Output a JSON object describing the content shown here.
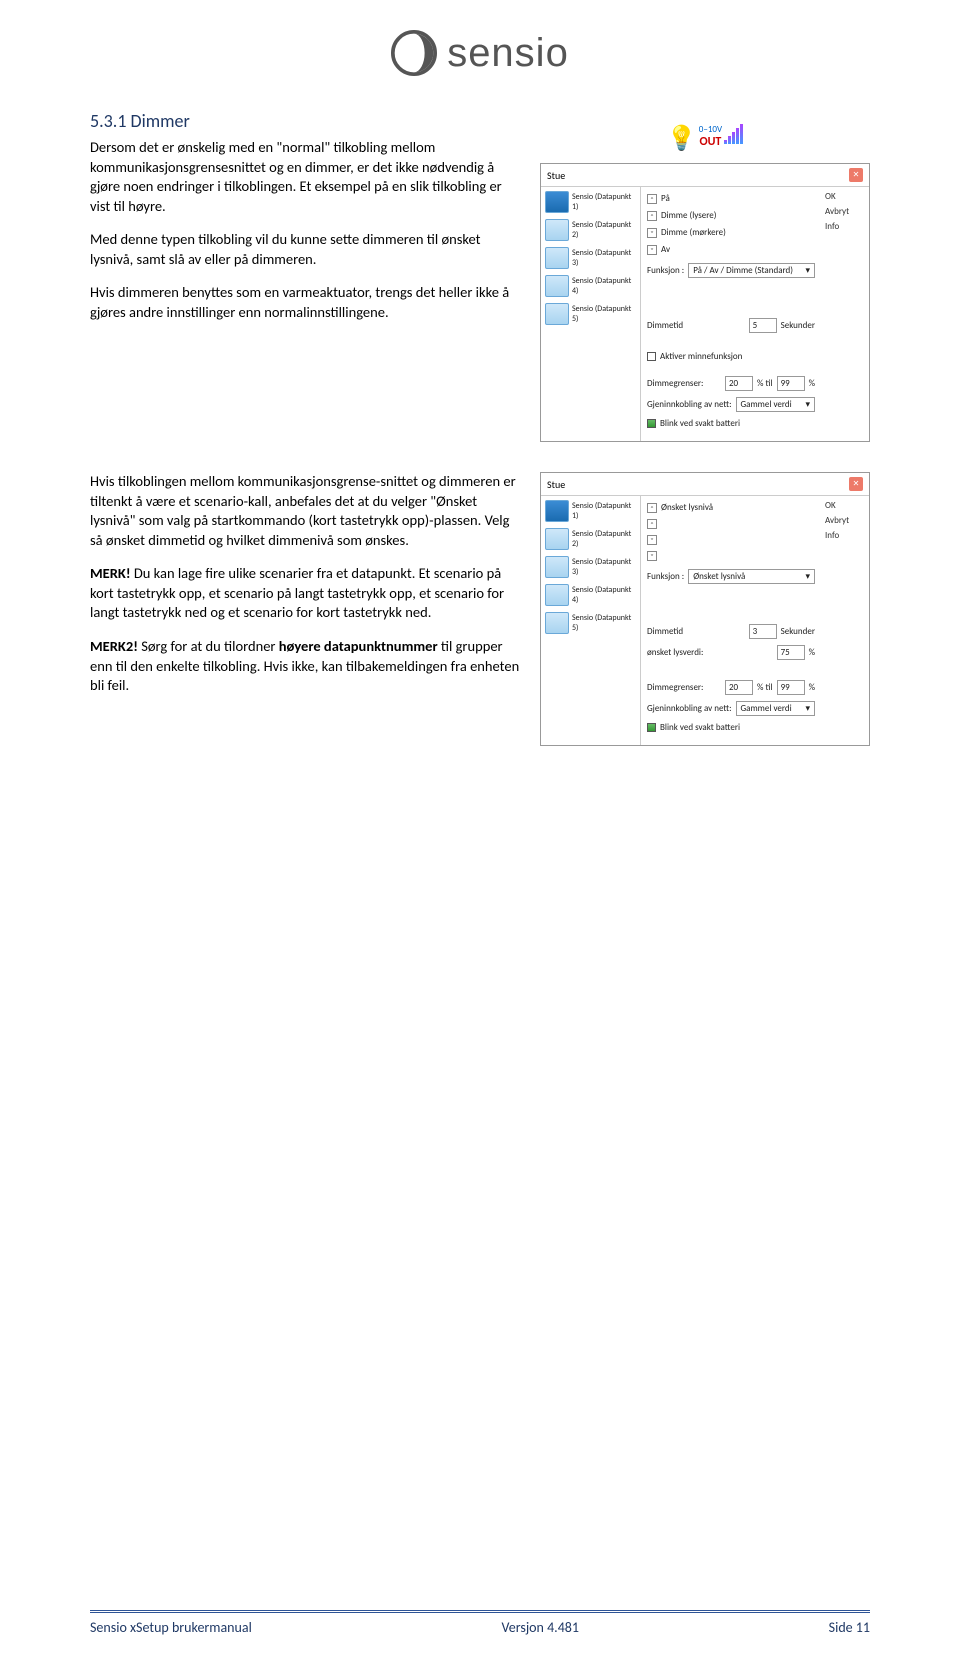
{
  "logo": {
    "brand": "sensio"
  },
  "heading": "5.3.1   Dimmer",
  "para1": "Dersom det er ønskelig med en \"normal\" tilkobling mellom kommunikasjonsgrensesnittet og en dimmer, er det ikke nødvendig å gjøre noen endringer i tilkoblingen. Et eksempel på en slik tilkobling er vist til høyre.",
  "para2": "Med denne typen tilkobling vil du kunne sette dimmeren til ønsket lysnivå, samt slå av eller på dimmeren.",
  "para3": "Hvis dimmeren benyttes som en varmeaktuator, trengs det heller ikke å gjøres andre innstillinger enn normalinnstillingene.",
  "para4": "Hvis tilkoblingen mellom kommunikasjonsgrense-snittet og dimmeren er tiltenkt å være et scenario-kall, anbefales det at du velger \"Ønsket lysnivå\" som valg på startkommando (kort tastetrykk opp)-plassen. Velg så ønsket dimmetid og hvilket dimmenivå som ønskes.",
  "para5a": "MERK!",
  "para5b": " Du kan lage fire ulike scenarier fra et datapunkt. Et scenario på kort tastetrykk opp, et scenario på langt tastetrykk opp, et scenario for langt tastetrykk ned og et scenario for kort tastetrykk ned.",
  "para6a": "MERK2!",
  "para6b": " Sørg for at du tilordner ",
  "para6c": "høyere datapunktnummer",
  "para6d": " til grupper enn til den enkelte tilkobling. Hvis ikke, kan tilbakemeldingen fra enheten bli feil.",
  "topbadge": {
    "out": "OUT",
    "volt": "0–10V"
  },
  "ss1": {
    "title": "Stue",
    "devices": [
      "Sensio (Datapunkt 1)",
      "Sensio (Datapunkt 2)",
      "Sensio (Datapunkt 3)",
      "Sensio (Datapunkt 4)",
      "Sensio (Datapunkt 5)"
    ],
    "selected": "Sensio (Datapunkt 1)",
    "opts": [
      "På",
      "Dimme (lysere)",
      "Dimme (mørkere)",
      "Av"
    ],
    "funk_label": "Funksjon :",
    "funk_value": "På / Av / Dimme (Standard)",
    "dimmetid_label": "Dimmetid",
    "dimmetid_val": "5",
    "dimmetid_unit": "Sekunder",
    "mem_label": "Aktiver minnefunksjon",
    "range_label": "Dimmegrenser:",
    "range_lo": "20",
    "range_mid": "% til",
    "range_hi": "99",
    "range_suf": "%",
    "gjen_label": "Gjeninnkobling av nett:",
    "gjen_val": "Gammel verdi",
    "blink_label": "Blink ved svakt batteri",
    "buttons": [
      "OK",
      "Avbryt",
      "Info"
    ]
  },
  "ss2": {
    "title": "Stue",
    "devices": [
      "Sensio (Datapunkt 1)",
      "Sensio (Datapunkt 2)",
      "Sensio (Datapunkt 3)",
      "Sensio (Datapunkt 4)",
      "Sensio (Datapunkt 5)"
    ],
    "selected": "Sensio (Datapunkt 1)",
    "opts": [
      "Ønsket lysnivå",
      "",
      "",
      ""
    ],
    "funk_label": "Funksjon :",
    "funk_value": "Ønsket lysnivå",
    "dimmetid_label": "Dimmetid",
    "dimmetid_val": "3",
    "dimmetid_unit": "Sekunder",
    "lys_label": "ønsket lysverdi:",
    "lys_val": "75",
    "lys_suf": "%",
    "range_label": "Dimmegrenser:",
    "range_lo": "20",
    "range_mid": "% til",
    "range_hi": "99",
    "range_suf": "%",
    "gjen_label": "Gjeninnkobling av nett:",
    "gjen_val": "Gammel verdi",
    "blink_label": "Blink ved svakt batteri",
    "buttons": [
      "OK",
      "Avbryt",
      "Info"
    ]
  },
  "footer": {
    "left": "Sensio xSetup brukermanual",
    "center": "Versjon 4.481",
    "right": "Side 11"
  }
}
